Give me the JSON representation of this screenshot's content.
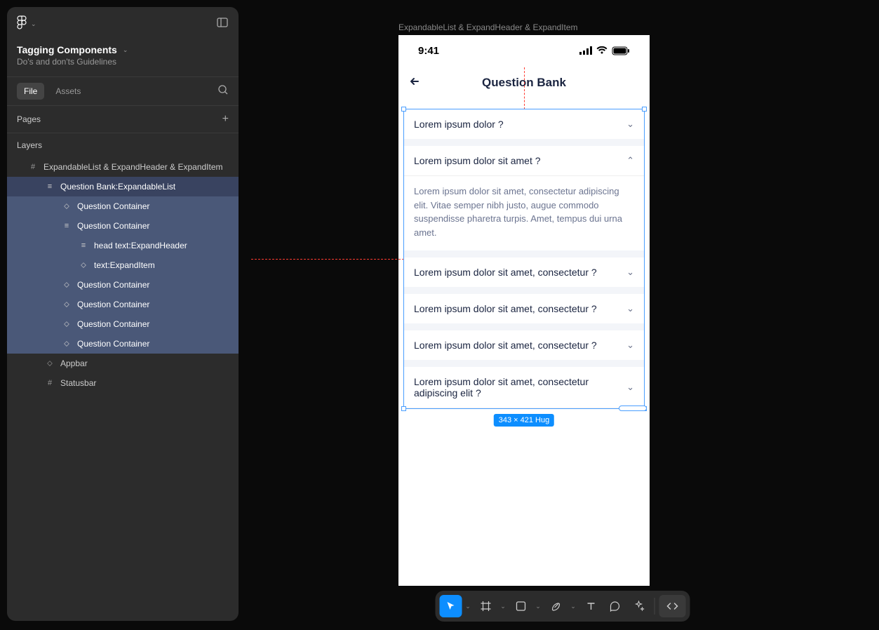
{
  "project": {
    "title": "Tagging Components",
    "subtitle": "Do's and don'ts Guidelines"
  },
  "tabs": {
    "file": "File",
    "assets": "Assets"
  },
  "sections": {
    "pages": "Pages",
    "layers": "Layers"
  },
  "layers": [
    {
      "icon": "frame",
      "label": "ExpandableList & ExpandHeader & ExpandItem",
      "indent": 1,
      "state": ""
    },
    {
      "icon": "vstack",
      "label": "Question Bank:ExpandableList",
      "indent": 2,
      "state": "active"
    },
    {
      "icon": "comp",
      "label": "Question Container",
      "indent": 3,
      "state": "selected"
    },
    {
      "icon": "vstack",
      "label": "Question Container",
      "indent": 3,
      "state": "selected"
    },
    {
      "icon": "vstack",
      "label": "head text:ExpandHeader",
      "indent": 4,
      "state": "selected"
    },
    {
      "icon": "comp",
      "label": "text:ExpandItem",
      "indent": 4,
      "state": "selected"
    },
    {
      "icon": "comp",
      "label": "Question Container",
      "indent": 3,
      "state": "selected"
    },
    {
      "icon": "comp",
      "label": "Question Container",
      "indent": 3,
      "state": "selected"
    },
    {
      "icon": "comp",
      "label": "Question Container",
      "indent": 3,
      "state": "selected"
    },
    {
      "icon": "comp",
      "label": "Question Container",
      "indent": 3,
      "state": "selected"
    },
    {
      "icon": "comp",
      "label": "Appbar",
      "indent": 2,
      "state": ""
    },
    {
      "icon": "frame",
      "label": "Statusbar",
      "indent": 2,
      "state": ""
    }
  ],
  "canvas": {
    "frameLabel": "ExpandableList & ExpandHeader & ExpandItem",
    "dimensions": "343 × 421 Hug"
  },
  "mobile": {
    "time": "9:41",
    "appTitle": "Question Bank",
    "questions": [
      {
        "title": "Lorem ipsum dolor ?",
        "expanded": false,
        "body": ""
      },
      {
        "title": "Lorem ipsum dolor sit amet ?",
        "expanded": true,
        "body": "Lorem ipsum dolor sit amet, consectetur adipiscing elit. Vitae semper nibh justo, augue commodo suspendisse pharetra turpis. Amet, tempus dui urna amet."
      },
      {
        "title": "Lorem ipsum dolor sit amet, consectetur ?",
        "expanded": false,
        "body": ""
      },
      {
        "title": "Lorem ipsum dolor sit amet, consectetur ?",
        "expanded": false,
        "body": ""
      },
      {
        "title": "Lorem ipsum dolor sit amet, consectetur ?",
        "expanded": false,
        "body": ""
      },
      {
        "title": "Lorem ipsum dolor sit amet, consectetur adipiscing elit ?",
        "expanded": false,
        "body": ""
      }
    ]
  }
}
